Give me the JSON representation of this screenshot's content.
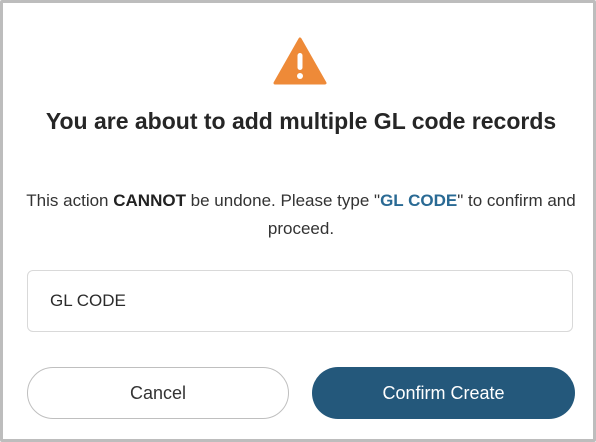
{
  "dialog": {
    "icon": "warning-icon",
    "title": "You are about to add multiple GL code records",
    "message": {
      "part1": "This action ",
      "emphasis": "CANNOT",
      "part2": " be undone. Please type \"",
      "keyword": "GL CODE",
      "part3": "\" to confirm and proceed."
    },
    "input": {
      "value": "GL CODE",
      "placeholder": ""
    },
    "buttons": {
      "cancel_label": "Cancel",
      "confirm_label": "Confirm Create"
    },
    "colors": {
      "warning": "#EE8A38",
      "primary": "#24587B",
      "keyword": "#2A6A94"
    }
  }
}
